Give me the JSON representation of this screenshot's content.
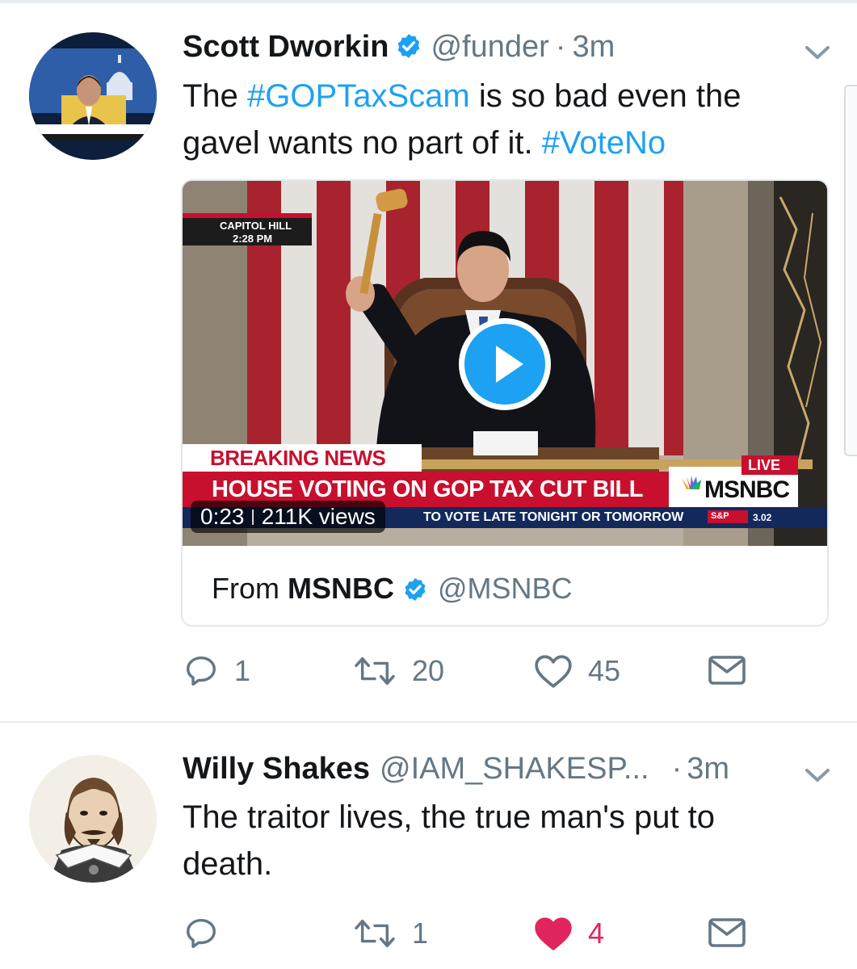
{
  "tweets": [
    {
      "author_name": "Scott Dworkin",
      "handle": "@funder",
      "separator": "·",
      "time": "3m",
      "text_parts": [
        {
          "text": "The ",
          "hashtag": false
        },
        {
          "text": "#GOPTaxScam",
          "hashtag": true
        },
        {
          "text": " is so bad even the gavel wants no part of it. ",
          "hashtag": false
        },
        {
          "text": "#VoteNo",
          "hashtag": true
        }
      ],
      "video": {
        "location_label": "CAPITOL HILL",
        "time_label": "2:28 PM",
        "breaking_label": "BREAKING NEWS",
        "headline": "HOUSE VOTING ON GOP TAX CUT BILL",
        "live_label": "LIVE",
        "network_label": "MSNBC",
        "ticker": "TO VOTE LATE TONIGHT OR TOMORROW",
        "market_label": "S&P",
        "market_value": "3.02",
        "duration": "0:23",
        "views": "211K views"
      },
      "from_label": "From",
      "from_name": "MSNBC",
      "from_handle": "@MSNBC",
      "reply_count": "1",
      "retweet_count": "20",
      "like_count": "45",
      "liked": false
    },
    {
      "author_name": "Willy Shakes",
      "handle": "@IAM_SHAKESP...",
      "separator": "·",
      "time": "3m",
      "text": "The traitor lives, the true man's put to death.",
      "reply_count": "",
      "retweet_count": "1",
      "like_count": "4",
      "liked": true
    }
  ],
  "colors": {
    "link": "#1da1f2",
    "muted": "#657786",
    "like": "#e0245e",
    "verified": "#1da1f2",
    "breaking_red": "#c8102e"
  }
}
